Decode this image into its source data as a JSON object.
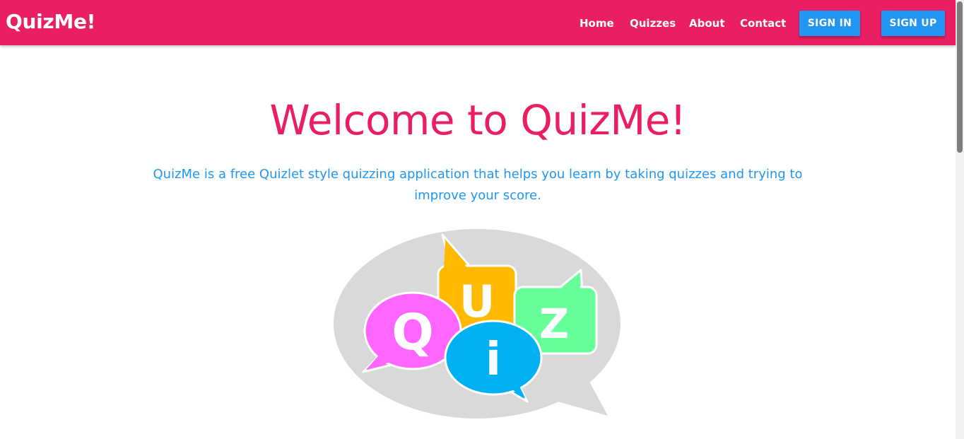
{
  "navbar": {
    "brand": "QuizMe!",
    "links": [
      "Home",
      "Quizzes",
      "About",
      "Contact"
    ],
    "sign_in_label": "SIGN IN",
    "sign_up_label": "SIGN UP"
  },
  "hero": {
    "title": "Welcome to QuizMe!",
    "description": "QuizMe is a free Quizlet style quizzing application that helps you learn by taking quizzes and trying to improve your score."
  },
  "logo": {
    "letters": [
      "Q",
      "U",
      "i",
      "Z"
    ]
  },
  "colors": {
    "primary": "#e91e63",
    "accent": "#2196f3",
    "bubble_magenta": "#ff66ff",
    "bubble_yellow": "#ffb900",
    "bubble_green": "#66ff99",
    "bubble_blue": "#00b0f0",
    "bubble_gray": "#d9d9d9"
  }
}
